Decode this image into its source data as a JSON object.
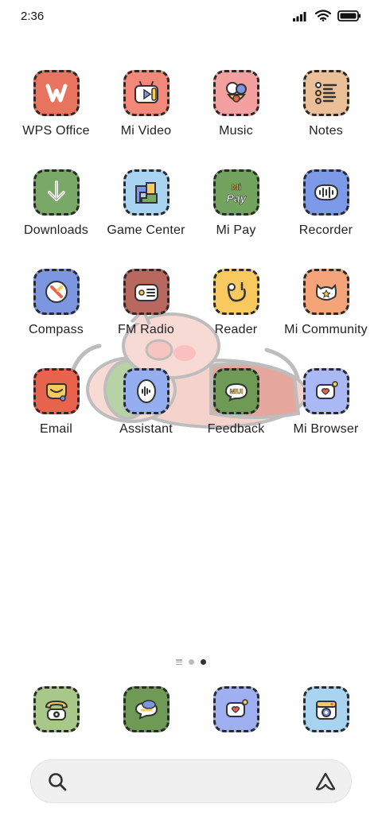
{
  "status_bar": {
    "time": "2:36"
  },
  "apps": [
    {
      "label": "WPS Office",
      "icon": "wps-office-icon",
      "color": "#e8735f"
    },
    {
      "label": "Mi Video",
      "icon": "mi-video-icon",
      "color": "#f2887a"
    },
    {
      "label": "Music",
      "icon": "music-icon",
      "color": "#f5a0a0"
    },
    {
      "label": "Notes",
      "icon": "notes-icon",
      "color": "#ebbf98"
    },
    {
      "label": "Downloads",
      "icon": "downloads-icon",
      "color": "#7aa866"
    },
    {
      "label": "Game Center",
      "icon": "game-center-icon",
      "color": "#a8d4f2"
    },
    {
      "label": "Mi Pay",
      "icon": "mi-pay-icon",
      "color": "#72a35f"
    },
    {
      "label": "Recorder",
      "icon": "recorder-icon",
      "color": "#7d9ae8"
    },
    {
      "label": "Compass",
      "icon": "compass-icon",
      "color": "#7d96e0"
    },
    {
      "label": "FM Radio",
      "icon": "fm-radio-icon",
      "color": "#b8685e"
    },
    {
      "label": "Reader",
      "icon": "reader-icon",
      "color": "#f8c95e"
    },
    {
      "label": "Mi Community",
      "icon": "mi-community-icon",
      "color": "#f5a47a"
    },
    {
      "label": "Email",
      "icon": "email-icon",
      "color": "#e8634e"
    },
    {
      "label": "Assistant",
      "icon": "assistant-app-icon",
      "color": "#94aef0"
    },
    {
      "label": "Feedback",
      "icon": "feedback-icon",
      "color": "#6e9a56"
    },
    {
      "label": "Mi Browser",
      "icon": "mi-browser-icon",
      "color": "#aab8f5"
    }
  ],
  "dock": [
    {
      "icon": "phone-icon",
      "color": "#a8c88a"
    },
    {
      "icon": "messages-icon",
      "color": "#6e9a56"
    },
    {
      "icon": "mi-browser-icon",
      "color": "#9fb0f2"
    },
    {
      "icon": "camera-icon",
      "color": "#a8d4f2"
    }
  ],
  "page_indicator": {
    "pages": 2,
    "active": 2
  },
  "search": {
    "icon": "search-icon",
    "right_icon": "assistant-icon"
  }
}
